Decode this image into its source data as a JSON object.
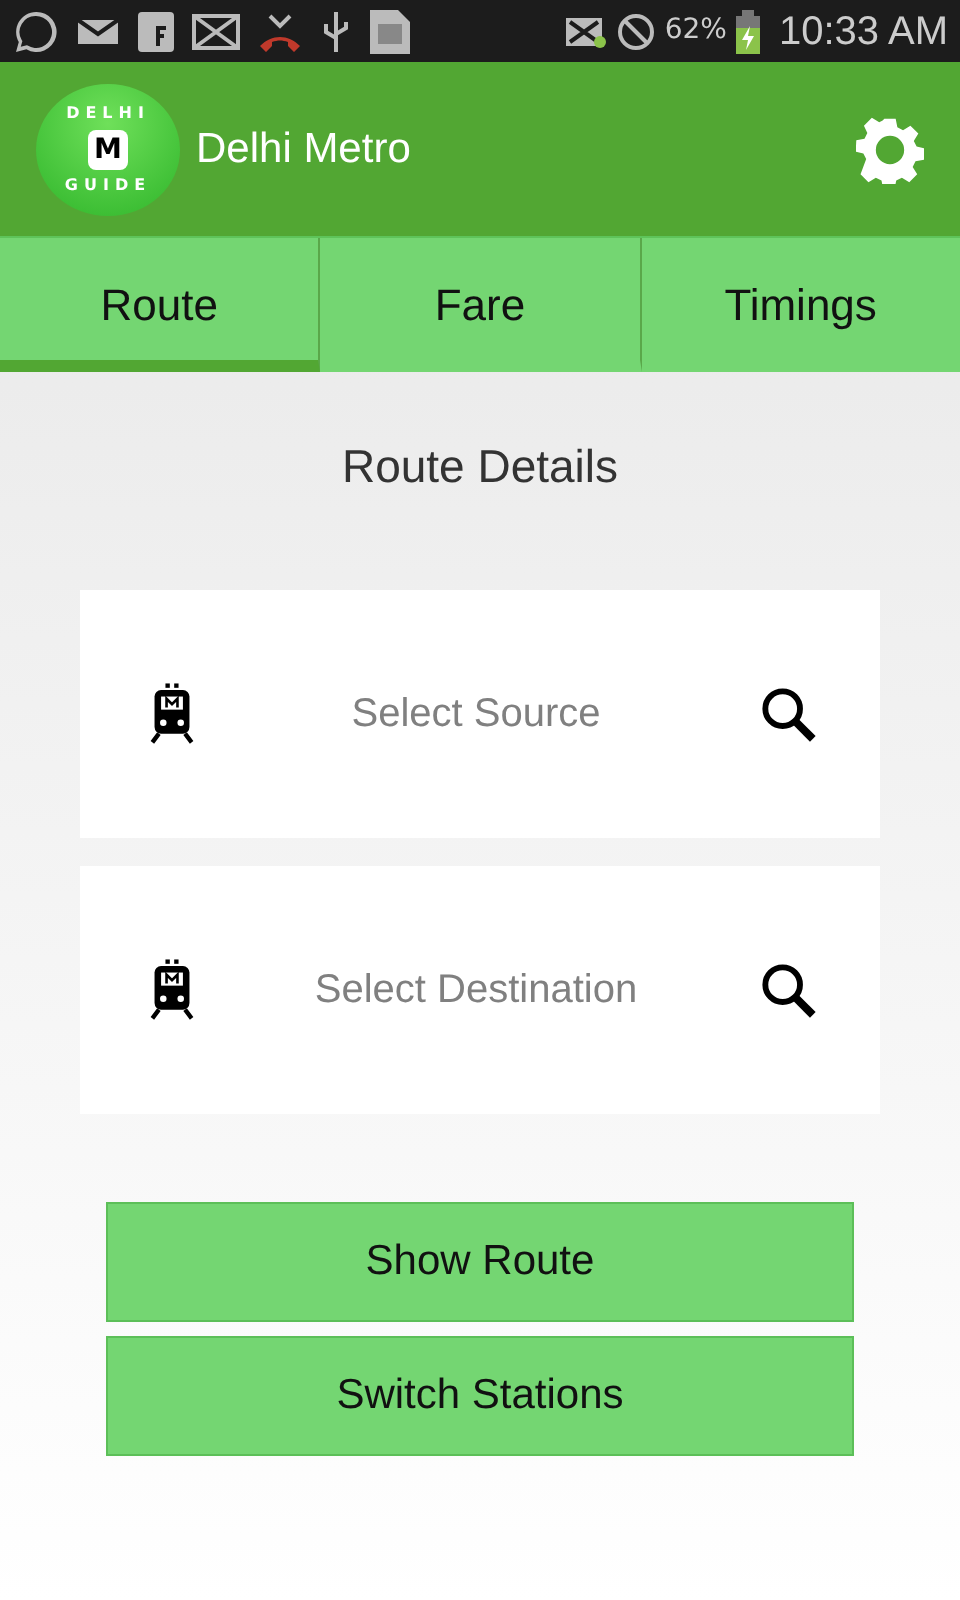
{
  "status_bar": {
    "battery_text": "62%",
    "time": "10:33 AM"
  },
  "app_bar": {
    "logo": {
      "top": "DELHI",
      "center": "M",
      "bottom": "GUIDE"
    },
    "title": "Delhi Metro"
  },
  "tabs": [
    {
      "label": "Route",
      "selected": true
    },
    {
      "label": "Fare",
      "selected": false
    },
    {
      "label": "Timings",
      "selected": false
    }
  ],
  "heading": "Route Details",
  "fields": [
    {
      "placeholder": "Select Source"
    },
    {
      "placeholder": "Select Destination"
    }
  ],
  "buttons": [
    "Show Route",
    "Switch Stations"
  ]
}
